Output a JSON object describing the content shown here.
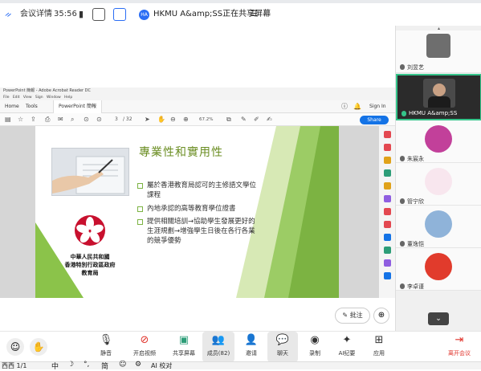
{
  "meeting": {
    "logo_label": "会议详情",
    "timer": "35:56",
    "presenter_badge": "HA",
    "banner": "HKMU A&amp;SS正在共享屏幕"
  },
  "reader": {
    "title": "PowerPoint 簡報 - Adobe Acrobat Reader DC",
    "menu": [
      "File",
      "Edit",
      "View",
      "Sign",
      "Window",
      "Help"
    ],
    "tabs": [
      "Home",
      "Tools",
      "PowerPoint 簡報"
    ],
    "sign_in": "Sign In",
    "page": "3",
    "total_pages": "/ 32",
    "zoom": "67.2%",
    "share_label": "Share"
  },
  "slide": {
    "title": "專業性和實用性",
    "bullets": [
      "屬於香港教育局認可的主修語文學位課程",
      "內地承認的高等教育學位證書",
      "提供相關培訓→協助學生發展更好的生涯規劃→增強學生日後在各行各業的競爭優勢"
    ],
    "gov_lines": [
      "中華人民共和國",
      "香港特別行政區政府",
      "教育局"
    ]
  },
  "participants": [
    {
      "name": "刘昱艺"
    },
    {
      "name": "HKMU A&amp;SS"
    },
    {
      "name": "朱宸永"
    },
    {
      "name": "管宁欣"
    },
    {
      "name": "董逸恺"
    },
    {
      "name": "李卓谨"
    }
  ],
  "overlay": {
    "annotate": "批注"
  },
  "toolbar": {
    "mute": "静音",
    "video": "开启视频",
    "share": "共享屏幕",
    "members": "成员(82)",
    "invite": "邀请",
    "chat": "聊天",
    "record": "录制",
    "ai": "AI纪要",
    "apps": "应用",
    "leave": "离开会议"
  },
  "taskbar": {
    "desktop": "西西 1/1",
    "ime": "中",
    "simp": "简",
    "ai_check": "AI 校对"
  },
  "colors": {
    "accent_green": "#35c48a",
    "leave_red": "#e0322a",
    "slide_green": "#7cb342",
    "share_blue": "#1473e6"
  }
}
